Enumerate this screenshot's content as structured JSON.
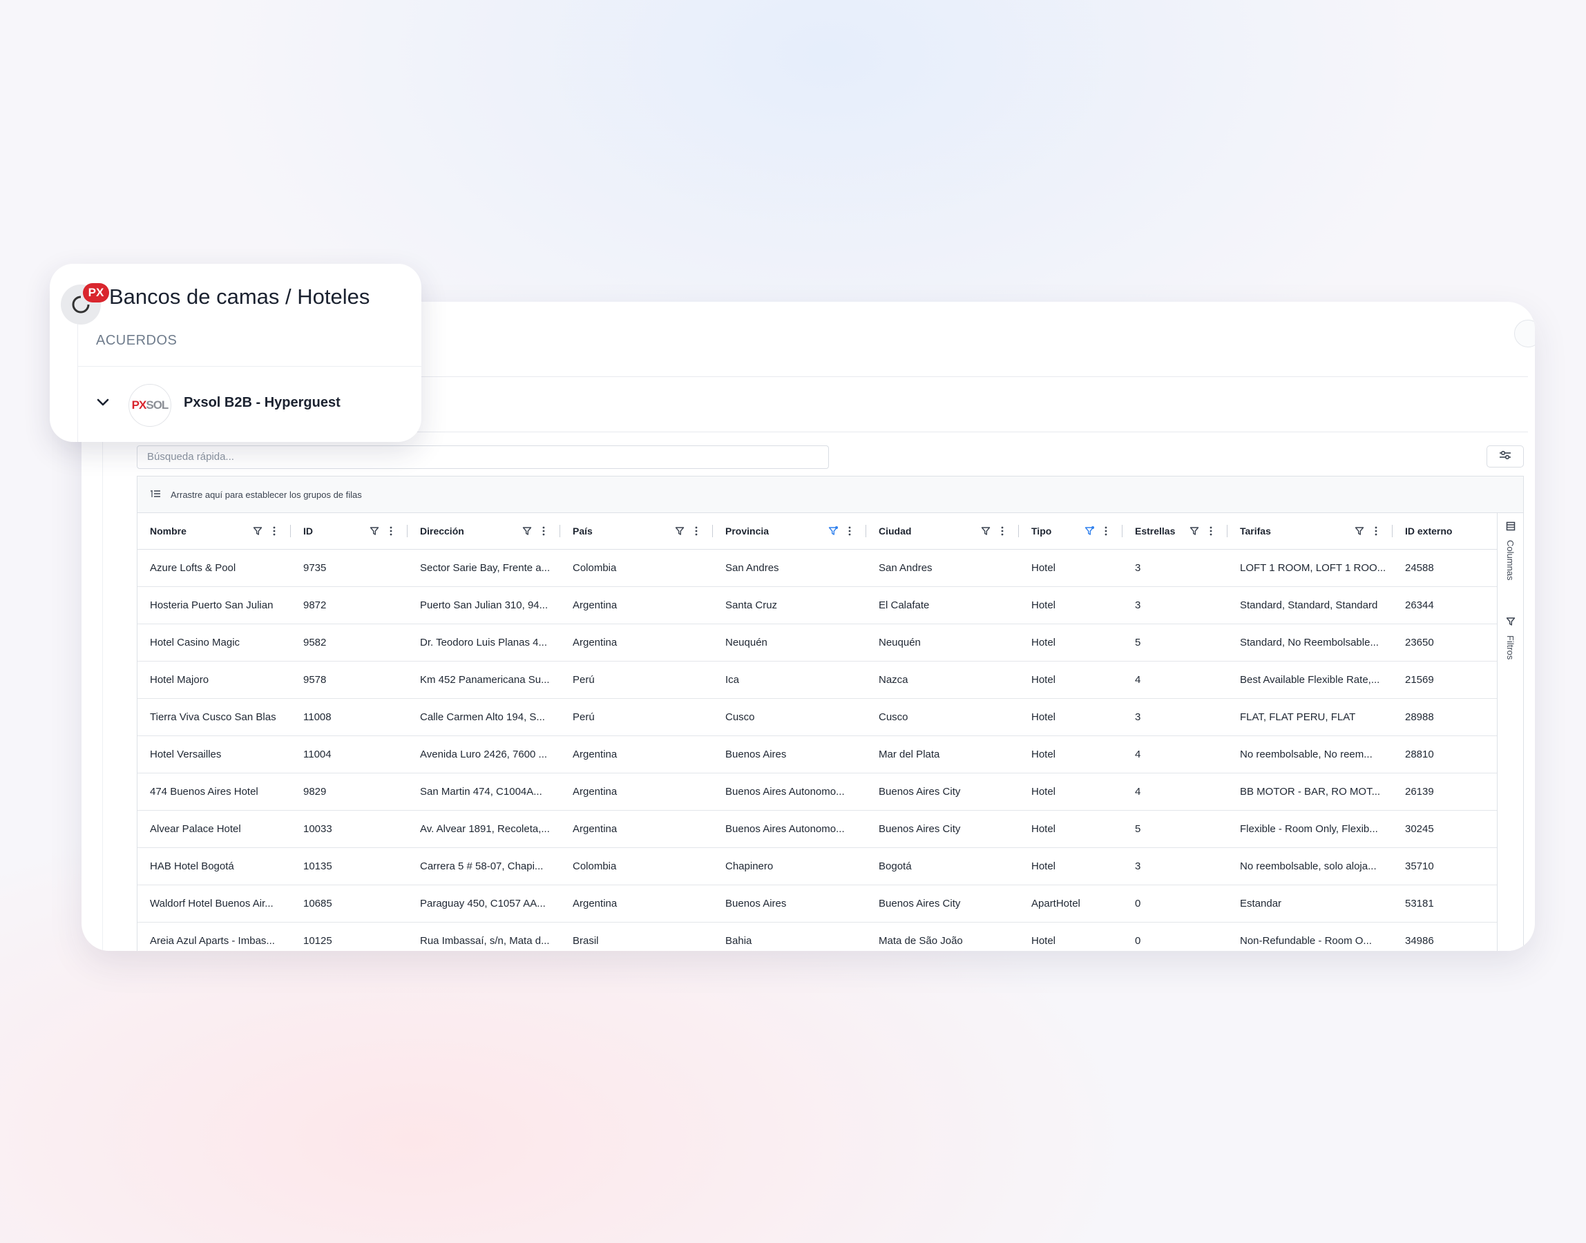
{
  "app": {
    "breadcrumb_title": "Bancos de camas / Hoteles",
    "section_label": "ACUERDOS",
    "agreement_name": "Pxsol B2B - Hyperguest",
    "brand_badge": "PX",
    "logo_text_a": "PX",
    "logo_text_b": "SOL",
    "brand_color": "#d9262e"
  },
  "toolbar": {
    "search_placeholder": "Búsqueda rápida...",
    "settings_icon": "sliders-icon"
  },
  "grid": {
    "group_bar_text": "Arrastre aquí para establecer los grupos de filas",
    "columns": [
      {
        "label": "Nombre",
        "filter_active": false
      },
      {
        "label": "ID",
        "filter_active": false
      },
      {
        "label": "Dirección",
        "filter_active": false
      },
      {
        "label": "País",
        "filter_active": false
      },
      {
        "label": "Provincia",
        "filter_active": true
      },
      {
        "label": "Ciudad",
        "filter_active": false
      },
      {
        "label": "Tipo",
        "filter_active": true
      },
      {
        "label": "Estrellas",
        "filter_active": false
      },
      {
        "label": "Tarifas",
        "filter_active": false
      },
      {
        "label": "ID externo",
        "filter_active": false
      }
    ],
    "rows": [
      [
        "Azure Lofts & Pool",
        "9735",
        "Sector Sarie Bay, Frente a...",
        "Colombia",
        "San Andres",
        "San Andres",
        "Hotel",
        "3",
        "LOFT 1 ROOM, LOFT 1 ROO...",
        "24588"
      ],
      [
        "Hosteria Puerto San Julian",
        "9872",
        "Puerto San Julian 310, 94...",
        "Argentina",
        "Santa Cruz",
        "El Calafate",
        "Hotel",
        "3",
        "Standard, Standard, Standard",
        "26344"
      ],
      [
        "Hotel Casino Magic",
        "9582",
        "Dr. Teodoro Luis Planas 4...",
        "Argentina",
        "Neuquén",
        "Neuquén",
        "Hotel",
        "5",
        "Standard, No Reembolsable...",
        "23650"
      ],
      [
        "Hotel Majoro",
        "9578",
        "Km 452 Panamericana Su...",
        "Perú",
        "Ica",
        "Nazca",
        "Hotel",
        "4",
        "Best Available Flexible Rate,...",
        "21569"
      ],
      [
        "Tierra Viva Cusco San Blas",
        "11008",
        "Calle Carmen Alto 194, S...",
        "Perú",
        "Cusco",
        "Cusco",
        "Hotel",
        "3",
        "FLAT, FLAT PERU, FLAT",
        "28988"
      ],
      [
        "Hotel Versailles",
        "11004",
        "Avenida Luro 2426, 7600 ...",
        "Argentina",
        "Buenos Aires",
        "Mar del Plata",
        "Hotel",
        "4",
        "No reembolsable, No reem...",
        "28810"
      ],
      [
        "474 Buenos Aires Hotel",
        "9829",
        "San Martin 474, C1004A...",
        "Argentina",
        "Buenos Aires Autonomo...",
        "Buenos Aires City",
        "Hotel",
        "4",
        "BB MOTOR - BAR, RO MOT...",
        "26139"
      ],
      [
        "Alvear Palace Hotel",
        "10033",
        "Av. Alvear 1891, Recoleta,...",
        "Argentina",
        "Buenos Aires Autonomo...",
        "Buenos Aires City",
        "Hotel",
        "5",
        "Flexible - Room Only, Flexib...",
        "30245"
      ],
      [
        "HAB Hotel Bogotá",
        "10135",
        "Carrera 5 # 58-07, Chapi...",
        "Colombia",
        "Chapinero",
        "Bogotá",
        "Hotel",
        "3",
        "No reembolsable, solo aloja...",
        "35710"
      ],
      [
        "Waldorf Hotel Buenos Air...",
        "10685",
        "Paraguay 450, C1057 AA...",
        "Argentina",
        "Buenos Aires",
        "Buenos Aires City",
        "ApartHotel",
        "0",
        "Estandar",
        "53181"
      ],
      [
        "Areia Azul Aparts - Imbas...",
        "10125",
        "Rua Imbassaí, s/n, Mata d...",
        "Brasil",
        "Bahia",
        "Mata de São João",
        "Hotel",
        "0",
        "Non-Refundable - Room O...",
        "34986"
      ]
    ]
  },
  "side_panel": {
    "columns_label": "Columnas",
    "filters_label": "Filtros"
  },
  "colors": {
    "filter_active": "#2f80ed",
    "badge_red": "#d9262e"
  }
}
